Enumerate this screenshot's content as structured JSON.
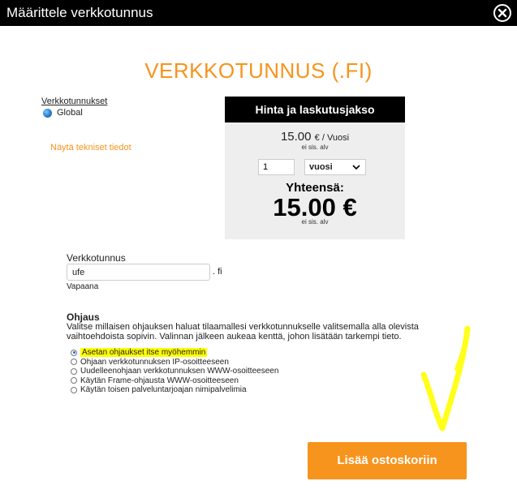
{
  "window": {
    "title": "Määrittele verkkotunnus"
  },
  "heading": "VERKKOTUNNUS (.FI)",
  "sidebar": {
    "domains_link": "Verkkotunnukset",
    "global_label": "Global",
    "tech_link": "Näytä tekniset tiedot"
  },
  "pricing": {
    "header": "Hinta ja laskutusjakso",
    "unit_price": "15.00",
    "unit_suffix": "€ / Vuosi",
    "vat_note": "ei sis. alv",
    "quantity": "1",
    "period": "vuosi",
    "total_label": "Yhteensä:",
    "total_value": "15.00 €",
    "total_vat_note": "ei sis. alv"
  },
  "domain": {
    "label": "Verkkotunnus",
    "value": "ufe",
    "tld": ". fi",
    "status": "Vapaana"
  },
  "routing": {
    "title": "Ohjaus",
    "description": "Valitse millaisen ohjauksen haluat tilaamallesi verkkotunnukselle valitsemalla alla olevista vaihtoehdoista sopivin. Valinnan jälkeen aukeaa kenttä, johon lisätään tarkempi tieto.",
    "options": [
      {
        "label": "Asetan ohjaukset itse myöhemmin",
        "selected": true
      },
      {
        "label": "Ohjaan verkkotunnuksen IP-osoitteeseen",
        "selected": false
      },
      {
        "label": "Uudelleenohjaan verkkotunnuksen WWW-osoitteeseen",
        "selected": false
      },
      {
        "label": "Käytän Frame-ohjausta WWW-osoitteeseen",
        "selected": false
      },
      {
        "label": "Käytän toisen palveluntarjoajan nimipalvelimia",
        "selected": false
      }
    ]
  },
  "actions": {
    "add_to_cart": "Lisää ostoskoriin"
  },
  "colors": {
    "accent": "#f7941d",
    "highlight": "#ffff00",
    "titlebar": "#000000"
  }
}
